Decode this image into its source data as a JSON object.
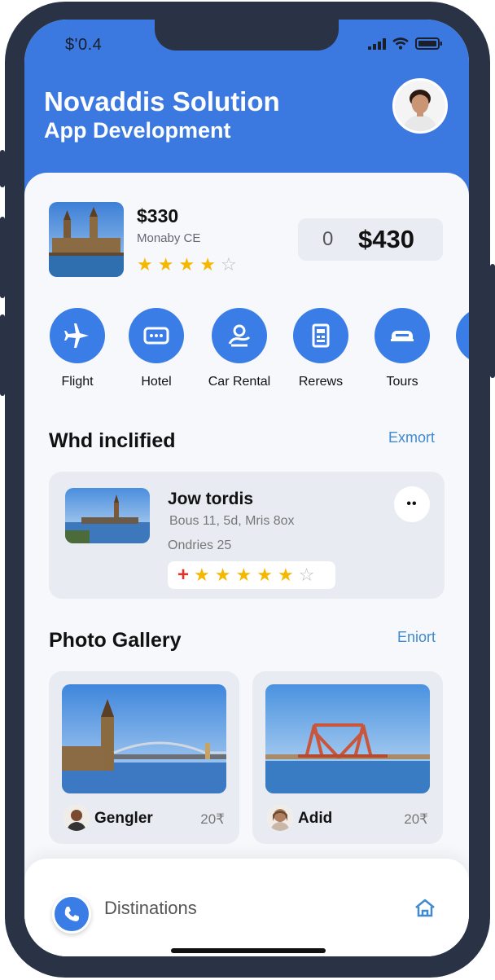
{
  "status_bar": {
    "time": "$'0.4"
  },
  "header": {
    "title": "Novaddis Solution",
    "subtitle": "App Development"
  },
  "hero": {
    "price": "$330",
    "subtitle": "Monaby CE",
    "rating": 4,
    "rating_max": 5,
    "price_zero": "0",
    "price_total": "$430"
  },
  "categories": [
    {
      "label": "Flight",
      "icon": "plane-icon"
    },
    {
      "label": "Hotel",
      "icon": "hotel-icon"
    },
    {
      "label": "Car Rental",
      "icon": "car-rental-icon"
    },
    {
      "label": "Rerews",
      "icon": "reviews-icon"
    },
    {
      "label": "Tours",
      "icon": "tours-icon"
    }
  ],
  "section1": {
    "title": "Whd inclified",
    "link": "Exmort"
  },
  "deal": {
    "title": "Jow tordis",
    "line1": "Bous 11, 5d, Mris 8ox",
    "line2": "Ondries 25",
    "rating": 5,
    "rating_max": 6
  },
  "gallery": {
    "title": "Photo Gallery",
    "link": "Eniort",
    "items": [
      {
        "name": "Gengler",
        "meta": "20₹"
      },
      {
        "name": "Adid",
        "meta": "20₹"
      }
    ]
  },
  "bottom_nav": {
    "label": "Distinations"
  },
  "colors": {
    "accent": "#3b79e0",
    "star": "#f5b800",
    "link": "#3f8ad0"
  }
}
